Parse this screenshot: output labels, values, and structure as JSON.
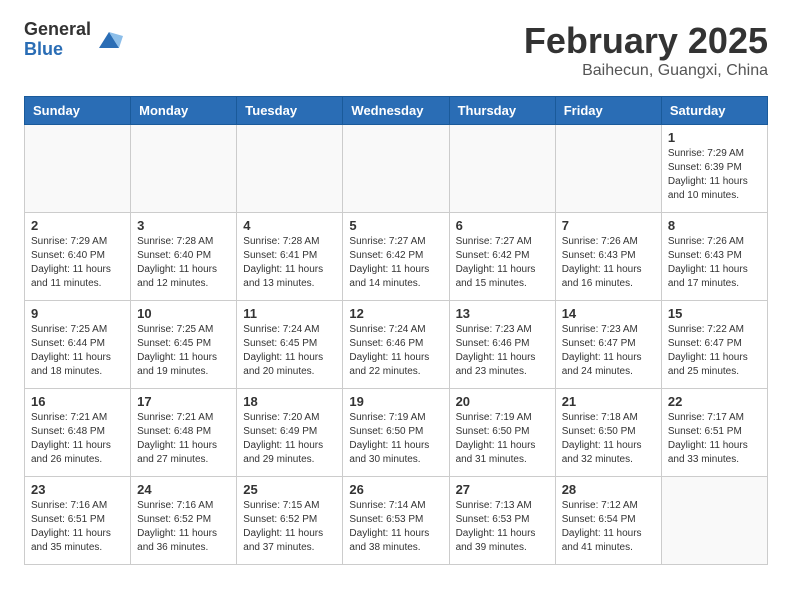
{
  "logo": {
    "general": "General",
    "blue": "Blue"
  },
  "title": "February 2025",
  "subtitle": "Baihecun, Guangxi, China",
  "days_of_week": [
    "Sunday",
    "Monday",
    "Tuesday",
    "Wednesday",
    "Thursday",
    "Friday",
    "Saturday"
  ],
  "weeks": [
    [
      {
        "day": "",
        "info": ""
      },
      {
        "day": "",
        "info": ""
      },
      {
        "day": "",
        "info": ""
      },
      {
        "day": "",
        "info": ""
      },
      {
        "day": "",
        "info": ""
      },
      {
        "day": "",
        "info": ""
      },
      {
        "day": "1",
        "info": "Sunrise: 7:29 AM\nSunset: 6:39 PM\nDaylight: 11 hours and 10 minutes."
      }
    ],
    [
      {
        "day": "2",
        "info": "Sunrise: 7:29 AM\nSunset: 6:40 PM\nDaylight: 11 hours and 11 minutes."
      },
      {
        "day": "3",
        "info": "Sunrise: 7:28 AM\nSunset: 6:40 PM\nDaylight: 11 hours and 12 minutes."
      },
      {
        "day": "4",
        "info": "Sunrise: 7:28 AM\nSunset: 6:41 PM\nDaylight: 11 hours and 13 minutes."
      },
      {
        "day": "5",
        "info": "Sunrise: 7:27 AM\nSunset: 6:42 PM\nDaylight: 11 hours and 14 minutes."
      },
      {
        "day": "6",
        "info": "Sunrise: 7:27 AM\nSunset: 6:42 PM\nDaylight: 11 hours and 15 minutes."
      },
      {
        "day": "7",
        "info": "Sunrise: 7:26 AM\nSunset: 6:43 PM\nDaylight: 11 hours and 16 minutes."
      },
      {
        "day": "8",
        "info": "Sunrise: 7:26 AM\nSunset: 6:43 PM\nDaylight: 11 hours and 17 minutes."
      }
    ],
    [
      {
        "day": "9",
        "info": "Sunrise: 7:25 AM\nSunset: 6:44 PM\nDaylight: 11 hours and 18 minutes."
      },
      {
        "day": "10",
        "info": "Sunrise: 7:25 AM\nSunset: 6:45 PM\nDaylight: 11 hours and 19 minutes."
      },
      {
        "day": "11",
        "info": "Sunrise: 7:24 AM\nSunset: 6:45 PM\nDaylight: 11 hours and 20 minutes."
      },
      {
        "day": "12",
        "info": "Sunrise: 7:24 AM\nSunset: 6:46 PM\nDaylight: 11 hours and 22 minutes."
      },
      {
        "day": "13",
        "info": "Sunrise: 7:23 AM\nSunset: 6:46 PM\nDaylight: 11 hours and 23 minutes."
      },
      {
        "day": "14",
        "info": "Sunrise: 7:23 AM\nSunset: 6:47 PM\nDaylight: 11 hours and 24 minutes."
      },
      {
        "day": "15",
        "info": "Sunrise: 7:22 AM\nSunset: 6:47 PM\nDaylight: 11 hours and 25 minutes."
      }
    ],
    [
      {
        "day": "16",
        "info": "Sunrise: 7:21 AM\nSunset: 6:48 PM\nDaylight: 11 hours and 26 minutes."
      },
      {
        "day": "17",
        "info": "Sunrise: 7:21 AM\nSunset: 6:48 PM\nDaylight: 11 hours and 27 minutes."
      },
      {
        "day": "18",
        "info": "Sunrise: 7:20 AM\nSunset: 6:49 PM\nDaylight: 11 hours and 29 minutes."
      },
      {
        "day": "19",
        "info": "Sunrise: 7:19 AM\nSunset: 6:50 PM\nDaylight: 11 hours and 30 minutes."
      },
      {
        "day": "20",
        "info": "Sunrise: 7:19 AM\nSunset: 6:50 PM\nDaylight: 11 hours and 31 minutes."
      },
      {
        "day": "21",
        "info": "Sunrise: 7:18 AM\nSunset: 6:50 PM\nDaylight: 11 hours and 32 minutes."
      },
      {
        "day": "22",
        "info": "Sunrise: 7:17 AM\nSunset: 6:51 PM\nDaylight: 11 hours and 33 minutes."
      }
    ],
    [
      {
        "day": "23",
        "info": "Sunrise: 7:16 AM\nSunset: 6:51 PM\nDaylight: 11 hours and 35 minutes."
      },
      {
        "day": "24",
        "info": "Sunrise: 7:16 AM\nSunset: 6:52 PM\nDaylight: 11 hours and 36 minutes."
      },
      {
        "day": "25",
        "info": "Sunrise: 7:15 AM\nSunset: 6:52 PM\nDaylight: 11 hours and 37 minutes."
      },
      {
        "day": "26",
        "info": "Sunrise: 7:14 AM\nSunset: 6:53 PM\nDaylight: 11 hours and 38 minutes."
      },
      {
        "day": "27",
        "info": "Sunrise: 7:13 AM\nSunset: 6:53 PM\nDaylight: 11 hours and 39 minutes."
      },
      {
        "day": "28",
        "info": "Sunrise: 7:12 AM\nSunset: 6:54 PM\nDaylight: 11 hours and 41 minutes."
      },
      {
        "day": "",
        "info": ""
      }
    ]
  ]
}
